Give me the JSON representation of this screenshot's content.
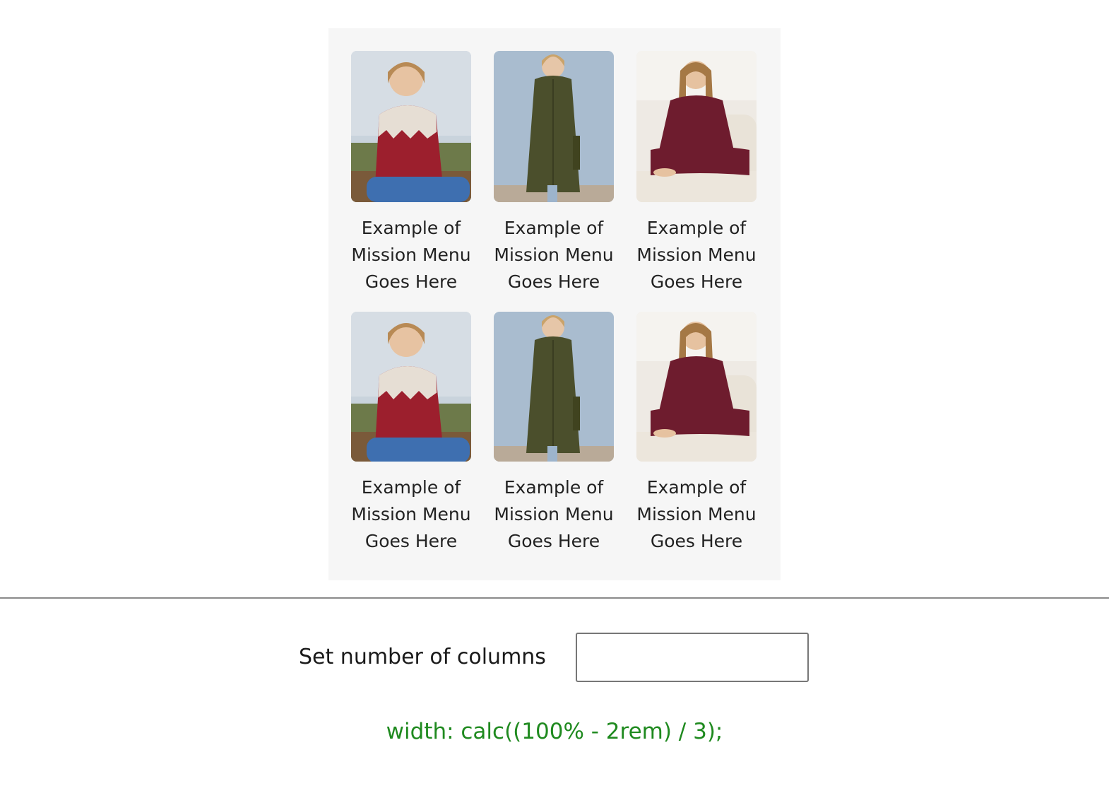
{
  "grid": {
    "columns": 3,
    "items": [
      {
        "caption": "Example of Mission Menu Goes Here",
        "image": "woman-red-sweater-photo"
      },
      {
        "caption": "Example of Mission Menu Goes Here",
        "image": "woman-olive-coat-photo"
      },
      {
        "caption": "Example of Mission Menu Goes Here",
        "image": "woman-burgundy-loungewear-photo"
      },
      {
        "caption": "Example of Mission Menu Goes Here",
        "image": "woman-red-sweater-photo"
      },
      {
        "caption": "Example of Mission Menu Goes Here",
        "image": "woman-olive-coat-photo"
      },
      {
        "caption": "Example of Mission Menu Goes Here",
        "image": "woman-burgundy-loungewear-photo"
      }
    ]
  },
  "controls": {
    "columns_label": "Set number of columns",
    "columns_value": "",
    "columns_placeholder": ""
  },
  "css_output": "width: calc((100% - 2rem) / 3);",
  "colors": {
    "panel_bg": "#f6f6f6",
    "css_output": "#1f8a1f"
  }
}
